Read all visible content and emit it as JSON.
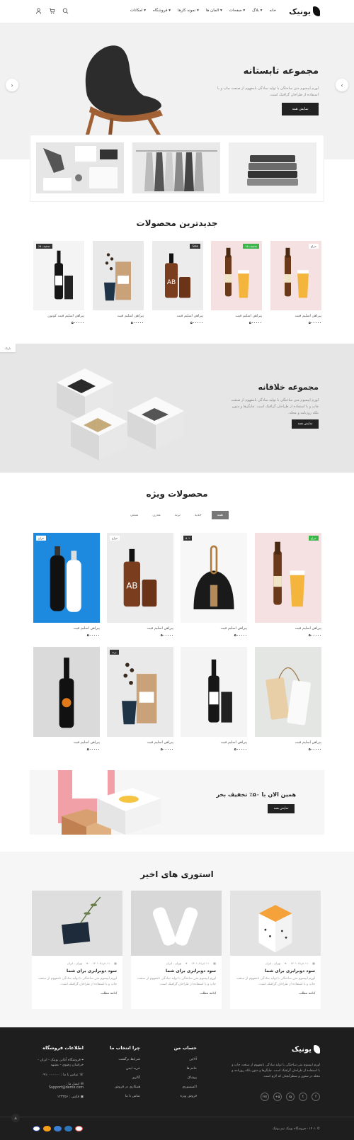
{
  "header": {
    "logo_text": "یونیک",
    "nav": [
      "خانه",
      "بلاگ",
      "صفحات",
      "المان ها",
      "نمونه کارها",
      "فروشگاه",
      "امکانات"
    ],
    "icons": [
      "search-icon",
      "cart-icon",
      "user-icon"
    ]
  },
  "hero": {
    "title": "مجموعه تابستانه",
    "description": "لورم ایپسوم متن ساختگی با تولید سادگی نامفهوم از صنعت چاپ و با استفاده از طراحان گرافیک است.",
    "button": "نمایش همه"
  },
  "latest": {
    "title": "جدیدترین محصولات",
    "items": [
      {
        "name": "پیراهن اسلیم فیت",
        "price": "۵۰۰۰۰۰",
        "badge": "حراج",
        "badge_style": "white",
        "art": "beer"
      },
      {
        "name": "پیراهن اسلیم فیت",
        "price": "۵۰۰۰۰۰",
        "badge": "تخفیف ۵٪",
        "badge_style": "green",
        "art": "beer"
      },
      {
        "name": "پیراهن اسلیم فیت",
        "price": "۵۰۰۰۰۰",
        "badge": "Sale",
        "badge_style": "dark",
        "art": "pump"
      },
      {
        "name": "پیراهن اسلیم فیت",
        "price": "۵۰۰۰۰۰",
        "badge": "",
        "badge_style": "",
        "art": "coffee"
      },
      {
        "name": "پیراهن اسلیم فیت کوتون",
        "price": "۵۰۰۰۰۰",
        "badge": "تخفیف ۵٪",
        "badge_style": "dark",
        "art": "wine"
      }
    ]
  },
  "creative": {
    "title": "مجموعه خلاقانه",
    "description": "لورم ایپسوم متن ساختگی با تولید سادگی نامفهوم از صنعت چاپ و با استفاده از طراحان گرافیک است. چاپگرها و متون بلکه روزنامه و مجله.",
    "button": "نمایش همه",
    "side_tab": "تاریک"
  },
  "featured": {
    "title": "محصولات ویژه",
    "filters": [
      "همه",
      "جدید",
      "ترند",
      "مدرن",
      "سنتی"
    ],
    "row1": [
      {
        "name": "پیراهن اسلیم فیت",
        "price": "۵۰۰۰۰۰",
        "badge": "حراج",
        "badge_style": "green",
        "art": "beer"
      },
      {
        "name": "پیراهن اسلیم فیت",
        "price": "۵۰۰۰۰۰",
        "badge": "۵۰٪",
        "badge_style": "dark",
        "art": "brush"
      },
      {
        "name": "پیراهن اسلیم فیت",
        "price": "۵۰۰۰۰۰",
        "badge": "حراج",
        "badge_style": "white",
        "art": "pump"
      },
      {
        "name": "پیراهن اسلیم فیت",
        "price": "۵۰۰۰۰۰",
        "badge": "حراج",
        "badge_style": "white",
        "art": "bottles"
      }
    ],
    "row2": [
      {
        "name": "پیراهن اسلیم فیت",
        "price": "۵۰۰۰۰۰",
        "badge": "",
        "badge_style": "",
        "art": "tags"
      },
      {
        "name": "پیراهن اسلیم فیت",
        "price": "۵۰۰۰۰۰",
        "badge": "",
        "badge_style": "",
        "art": "wine"
      },
      {
        "name": "پیراهن اسلیم فیت",
        "price": "۵۰۰۰۰۰",
        "badge": "ترند",
        "badge_style": "dark",
        "art": "coffee"
      },
      {
        "name": "پیراهن اسلیم فیت",
        "price": "۵۰۰۰۰۰",
        "badge": "",
        "badge_style": "",
        "art": "blackbottle"
      }
    ]
  },
  "promo": {
    "title": "همین الان با ۵۰٪ تخفیف بخر",
    "button": "نمایش همه"
  },
  "stories": {
    "title": "استوری های اخیر",
    "items": [
      {
        "date": "۱۱ خرداد ۱۴۰۱",
        "location": "تهران ، ایران",
        "title": "سود دوبرابری برای شما",
        "excerpt": "لورم ایپسوم متن ساختگی با تولید سادگی نامفهوم از صنعت چاپ و با استفاده از طراحان گرافیک است.",
        "more": "ادامه مطلب",
        "art": "box"
      },
      {
        "date": "۱۱ خرداد ۱۴۰۱",
        "location": "تهران ، ایران",
        "title": "سود دوبرابری برای شما",
        "excerpt": "لورم ایپسوم متن ساختگی با تولید سادگی نامفهوم از صنعت چاپ و با استفاده از طراحان گرافیک است.",
        "more": "ادامه مطلب",
        "art": "milk"
      },
      {
        "date": "۱۱ خرداد ۱۴۰۱",
        "location": "تهران ، ایران",
        "title": "سود دوبرابری برای شما",
        "excerpt": "لورم ایپسوم متن ساختگی با تولید سادگی نامفهوم از صنعت چاپ و با استفاده از طراحان گرافیک است.",
        "more": "ادامه مطلب",
        "art": "card"
      }
    ]
  },
  "footer": {
    "logo_text": "یونیک",
    "description": "لورم ایپسوم متن ساختگی با تولید سادگی نامفهوم از صنعت چاپ و با استفاده از طراحان گرافیک است. چاپگرها و متون بلکه روزنامه و مجله در ستون و سطرآنچنان که لازم است.",
    "social": [
      "f",
      "t",
      "ig",
      "g+",
      "rss"
    ],
    "account": {
      "title": "حساب من",
      "links": [
        "آلاچن",
        "خانم ها",
        "پوشاک",
        "اکسسوری",
        "فروش ویژه"
      ]
    },
    "why": {
      "title": "چرا انتخاب ما",
      "links": [
        "شرایط برگشت",
        "خرید ایمن",
        "گالری",
        "همکاری در فروش",
        "تماس با ما"
      ]
    },
    "info": {
      "title": "اطلاعات فروشگاه",
      "address": "فروشگاه آنلاین یونیک - ایران - خراسان رضوی - مشهد",
      "phone": "تماس با ما : ۰۹۱۰۰۰۰۰۰۰",
      "email_label": "ایمیل ما :",
      "email": "Support@demo.com",
      "fax": "فکس : ۱۲۳۴۵۶"
    },
    "copyright": "© ۱۴۰۱ - فروشگاه یونیک تیم یونیک",
    "payments": [
      "visa",
      "mastercard",
      "paypal",
      "amex",
      "discover"
    ]
  }
}
